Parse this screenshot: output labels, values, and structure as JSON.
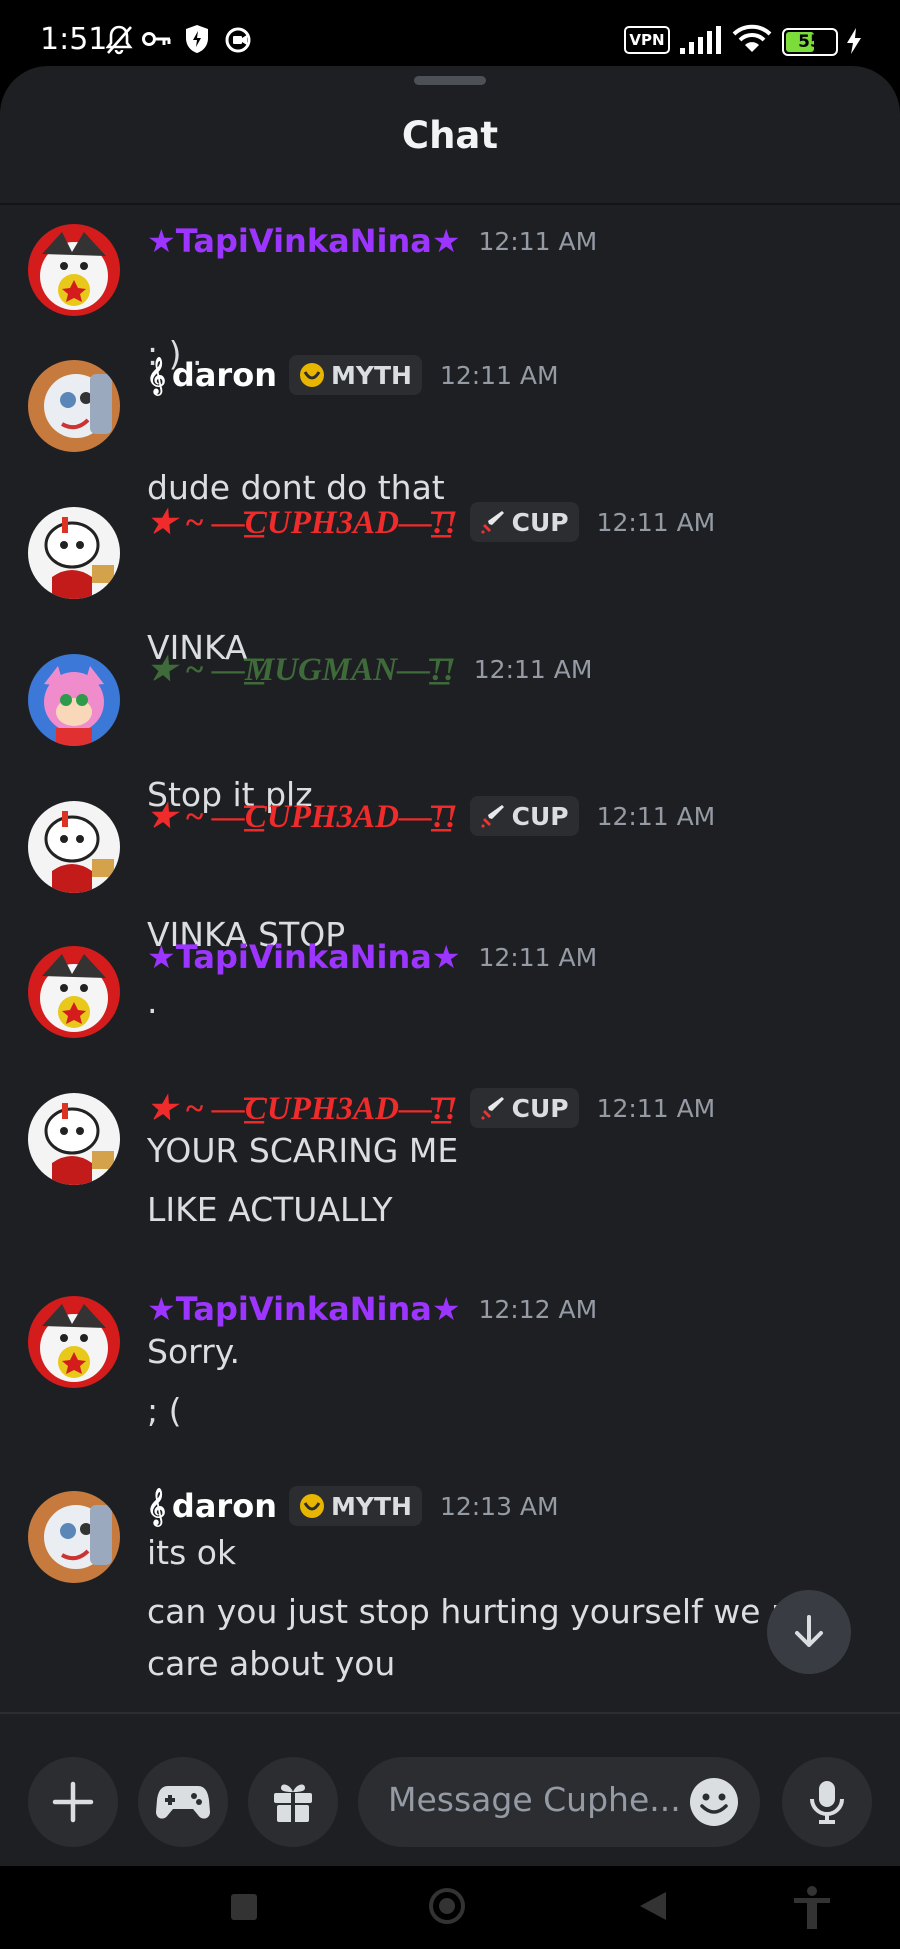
{
  "status_bar": {
    "time": "1:51",
    "vpn": "VPN",
    "battery": "55",
    "icons": [
      "mute-bell-icon",
      "key-icon",
      "shield-icon",
      "record-icon",
      "vpn-icon",
      "signal-icon",
      "wifi-icon",
      "battery-icon",
      "charging-icon"
    ]
  },
  "header": {
    "title": "Chat"
  },
  "messages": [
    {
      "user": "★TapiVinkaNina★",
      "color": "#9b35ff",
      "time": "12:11 AM",
      "lines": [
        ": ) ."
      ]
    },
    {
      "user": "daron",
      "prefix": "𝄞",
      "color": "#ffffff",
      "badge": "MYTH",
      "time": "12:11 AM",
      "lines": [
        "dude dont do that"
      ]
    },
    {
      "user": "★ ~ —͟͟͞͞CUPH3AD—͟͟͞͞!!",
      "color": "#ef2b2b",
      "badge": "CUP",
      "time": "12:11 AM",
      "lines": [
        "VINKA"
      ]
    },
    {
      "user": "★ ~ —͟͟͞͞MUGMAN—͟͟͞͞!!",
      "color": "#3f6b3a",
      "time": "12:11 AM",
      "lines": [
        "Stop it plz"
      ]
    },
    {
      "user": "★ ~ —͟͟͞͞CUPH3AD—͟͟͞͞!!",
      "color": "#ef2b2b",
      "badge": "CUP",
      "time": "12:11 AM",
      "lines": [
        "VINKA STOP"
      ]
    },
    {
      "user": "★TapiVinkaNina★",
      "color": "#9b35ff",
      "time": "12:11 AM",
      "lines": [
        "."
      ]
    },
    {
      "user": "★ ~ —͟͟͞͞CUPH3AD—͟͟͞͞!!",
      "color": "#ef2b2b",
      "badge": "CUP",
      "time": "12:11 AM",
      "lines": [
        "YOUR SCARING ME",
        "LIKE ACTUALLY"
      ]
    },
    {
      "user": "★TapiVinkaNina★",
      "color": "#9b35ff",
      "time": "12:12 AM",
      "lines": [
        "Sorry.",
        "; ("
      ]
    },
    {
      "user": "daron",
      "prefix": "𝄞",
      "color": "#ffffff",
      "badge": "MYTH",
      "time": "12:13 AM",
      "lines": [
        "its ok",
        "can you just stop hurting yourself we rea",
        "care about you"
      ]
    }
  ],
  "composer": {
    "placeholder": "Message Cuphe..."
  },
  "nav": [
    "square-icon",
    "home-circle-icon",
    "back-triangle-icon",
    "accessibility-icon"
  ]
}
